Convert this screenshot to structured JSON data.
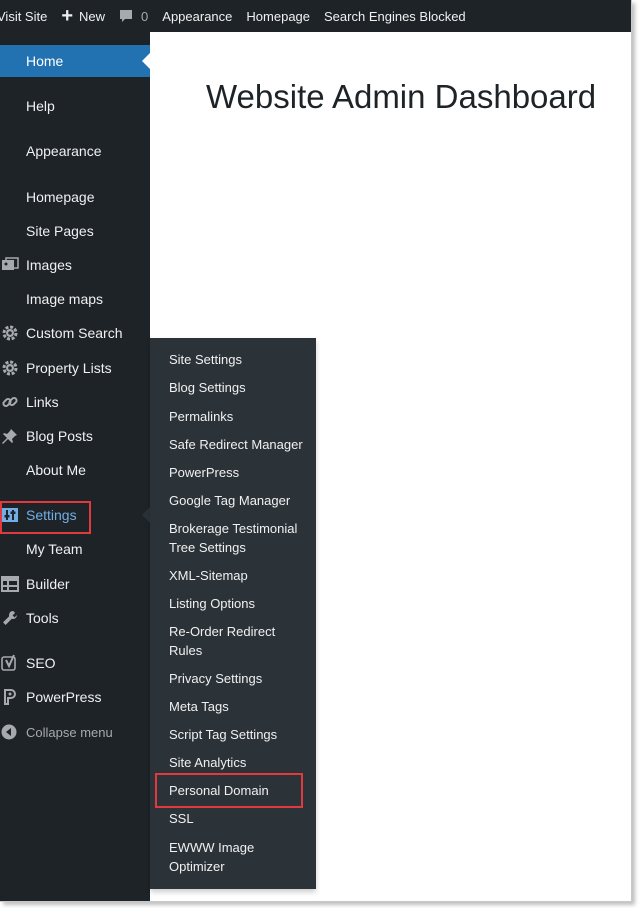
{
  "admin_bar": {
    "visit_site": "Visit Site",
    "new_label": "New",
    "comments_count": "0",
    "appearance": "Appearance",
    "homepage": "Homepage",
    "search_engines": "Search Engines Blocked"
  },
  "sidebar": {
    "items": [
      {
        "label": "Home",
        "icon": "",
        "current": true
      },
      {
        "label": "Help",
        "icon": ""
      },
      {
        "label": "Appearance",
        "icon": ""
      },
      {
        "label": "Homepage",
        "icon": ""
      },
      {
        "label": "Site Pages",
        "icon": ""
      },
      {
        "label": "Images",
        "icon": "images-icon"
      },
      {
        "label": "Image maps",
        "icon": ""
      },
      {
        "label": "Custom Search",
        "icon": "gear-icon"
      },
      {
        "label": "Property Lists",
        "icon": "gear-icon"
      },
      {
        "label": "Links",
        "icon": "link-icon"
      },
      {
        "label": "Blog Posts",
        "icon": "pin-icon"
      },
      {
        "label": "About Me",
        "icon": ""
      },
      {
        "label": "Settings",
        "icon": "sliders-icon",
        "open": true
      },
      {
        "label": "My Team",
        "icon": ""
      },
      {
        "label": "Builder",
        "icon": "grid-icon"
      },
      {
        "label": "Tools",
        "icon": "wrench-icon"
      },
      {
        "label": "SEO",
        "icon": "yoast-icon"
      },
      {
        "label": "PowerPress",
        "icon": "podcast-icon"
      },
      {
        "label": "Collapse menu",
        "icon": "collapse-icon"
      }
    ]
  },
  "main": {
    "title": "Website Admin Dashboard"
  },
  "settings_submenu": {
    "items": [
      "Site Settings",
      "Blog Settings",
      "Permalinks",
      "Safe Redirect Manager",
      "PowerPress",
      "Google Tag Manager",
      "Brokerage Testimonial Tree Settings",
      "XML-Sitemap",
      "Listing Options",
      "Re-Order Redirect Rules",
      "Privacy Settings",
      "Meta Tags",
      "Script Tag Settings",
      "Site Analytics",
      "Personal Domain",
      "SSL",
      "EWWW Image Optimizer"
    ]
  },
  "colors": {
    "admin_dark": "#1d2327",
    "submenu_bg": "#2c3338",
    "current_blue": "#2271b1",
    "highlight_red": "#e0393e"
  }
}
